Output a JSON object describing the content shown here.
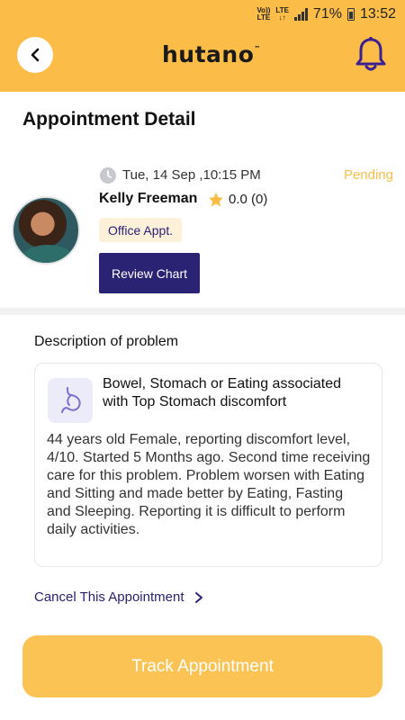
{
  "status_bar": {
    "network_top": "Vo))",
    "network_bottom": "LTE",
    "lte_label": "LTE",
    "battery": "71%",
    "time": "13:52"
  },
  "header": {
    "logo_text": "hutano",
    "logo_tm": "™",
    "back_icon": "chevron-left-icon",
    "bell_icon": "bell-icon"
  },
  "page": {
    "title": "Appointment Detail"
  },
  "appointment": {
    "datetime": "Tue, 14 Sep ,10:15 PM",
    "status": "Pending",
    "patient_name": "Kelly Freeman",
    "rating": "0.0 (0)",
    "type": "Office Appt.",
    "review_chart_label": "Review Chart"
  },
  "description": {
    "heading": "Description of problem",
    "problem_title": "Bowel, Stomach or Eating associated with Top Stomach discomfort",
    "problem_body": "44 years old Female, reporting discomfort level, 4/10. Started 5 Months ago. Second time receiving care for this problem. Problem worsen with Eating and Sitting and made better by Eating, Fasting  and Sleeping. Reporting it is difficult to perform daily activities."
  },
  "actions": {
    "cancel_label": "Cancel This Appointment",
    "track_label": "Track Appointment"
  },
  "colors": {
    "brand_yellow": "#fbbd48",
    "brand_purple": "#2a2273",
    "pending": "#fbbd48"
  }
}
